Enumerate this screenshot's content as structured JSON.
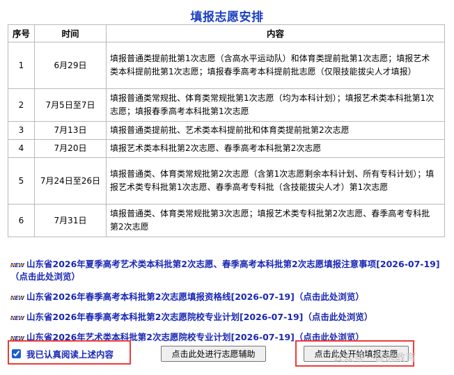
{
  "page": {
    "title": "填报志愿安排"
  },
  "table": {
    "headers": [
      "序号",
      "时间",
      "内容"
    ],
    "rows": [
      {
        "num": "1",
        "date": "6月29日",
        "content": "填报普通类提前批第1次志愿（含高水平运动队）和体育类提前批第1次志愿；填报艺术类本科提前批第1次志愿；填报春季高考本科提前批志愿（仅限技能拔尖人才填报）"
      },
      {
        "num": "2",
        "date": "7月5日至7日",
        "content": "填报普通类常规批、体育类常规批第1次志愿（均为本科计划）；填报艺术类本科批第1次志愿；填报春季高考本科批第1次志愿"
      },
      {
        "num": "3",
        "date": "7月13日",
        "content": "填报普通类提前批、艺术类本科提前批和体育类提前批第2次志愿"
      },
      {
        "num": "4",
        "date": "7月20日",
        "content": "填报艺术类本科批第2次志愿、春季高考本科批第2次志愿"
      },
      {
        "num": "5",
        "date": "7月24日至26日",
        "content": "填报普通类、体育类常规批第2次志愿（含第1次志愿剩余本科计划、所有专科计划）；填报艺术类专科批第1次志愿、春季高考专科批（含技能拔尖人才）第1次志愿"
      },
      {
        "num": "6",
        "date": "7月31日",
        "content": "填报普通类、体育类常规批第3次志愿；填报艺术类专科批第2次志愿、春季高考专科批第2次志愿"
      }
    ]
  },
  "news": {
    "badge": "NEW",
    "items": [
      "山东省2026年夏季高考艺术类本科批第2次志愿、春季高考本科批第2次志愿填报注意事项[2026-07-19]（点击此处浏览）",
      "山东省2026年春季高考本科批第2次志愿填报资格线[2026-07-19]（点击此处浏览）",
      "山东省2026年春季高考本科批第2次志愿院校专业计划[2026-07-19]（点击此处浏览）",
      "山东省2026年艺术类本科批第2次志愿院校专业计划[2026-07-19]（点击此处浏览）"
    ]
  },
  "controls": {
    "agree_label": "我已认真阅读上述内容",
    "agree_checked": true,
    "assist_button": "点击此处进行志愿辅助",
    "start_button": "点击此处开始填报志愿"
  },
  "watermark": {
    "text": "公众号 · 智远教育"
  },
  "colors": {
    "title": "#1a3fbf",
    "link": "#1a27b5",
    "highlight_box": "#ee3a3a"
  }
}
